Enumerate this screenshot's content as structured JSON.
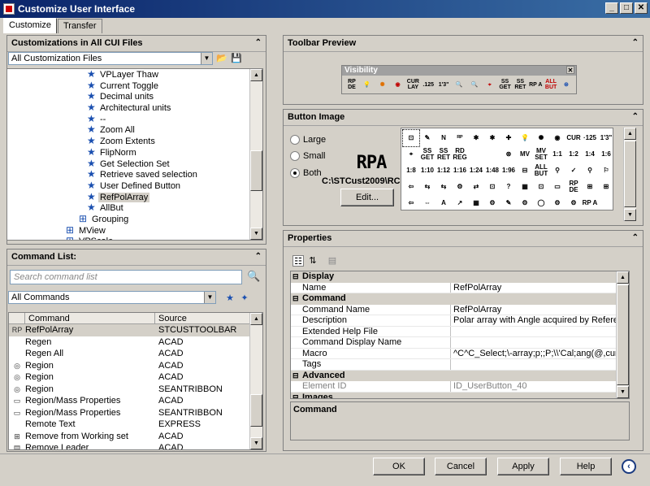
{
  "window": {
    "title": "Customize User Interface"
  },
  "tabs": [
    {
      "label": "Customize"
    },
    {
      "label": "Transfer"
    }
  ],
  "left_top": {
    "header": "Customizations in All CUI Files",
    "file_combo": "All Customization Files",
    "tree_items": [
      {
        "label": "VPLayer Thaw"
      },
      {
        "label": "Current Toggle"
      },
      {
        "label": "Decimal units"
      },
      {
        "label": "Architectural units"
      },
      {
        "label": "--"
      },
      {
        "label": "Zoom All"
      },
      {
        "label": "Zoom Extents"
      },
      {
        "label": "FlipNorm"
      },
      {
        "label": "Get Selection Set"
      },
      {
        "label": "Retrieve saved selection"
      },
      {
        "label": "User Defined Button"
      },
      {
        "label": "RefPolArray"
      },
      {
        "label": "AllBut"
      },
      {
        "label": "Grouping"
      },
      {
        "label": "MView"
      },
      {
        "label": "VPScale"
      }
    ]
  },
  "command_list": {
    "header": "Command List:",
    "search_placeholder": "Search command list",
    "filter_combo": "All Commands",
    "col_command": "Command",
    "col_source": "Source",
    "rows": [
      {
        "icon": "RP",
        "command": "RefPolArray",
        "source": "STCUSTTOOLBAR"
      },
      {
        "icon": "",
        "command": "Regen",
        "source": "ACAD"
      },
      {
        "icon": "",
        "command": "Regen All",
        "source": "ACAD"
      },
      {
        "icon": "◎",
        "command": "Region",
        "source": "ACAD"
      },
      {
        "icon": "◎",
        "command": "Region",
        "source": "ACAD"
      },
      {
        "icon": "◎",
        "command": "Region",
        "source": "SEANTRIBBON"
      },
      {
        "icon": "▭",
        "command": "Region/Mass Properties",
        "source": "ACAD"
      },
      {
        "icon": "▭",
        "command": "Region/Mass Properties",
        "source": "SEANTRIBBON"
      },
      {
        "icon": "",
        "command": "Remote Text",
        "source": "EXPRESS"
      },
      {
        "icon": "⊞",
        "command": "Remove from Working set",
        "source": "ACAD"
      },
      {
        "icon": "▤",
        "command": "Remove Leader",
        "source": "ACAD"
      }
    ]
  },
  "toolbar_preview": {
    "header": "Toolbar Preview",
    "toolbar_title": "Visibility",
    "icons": [
      "RP DE",
      "💡",
      "✺",
      "◉",
      "CUR LAY",
      ".125",
      "1'3\"",
      "🔍",
      "🔍",
      "⌖",
      "SS GET",
      "SS RET",
      "RP A",
      "ALL BUT",
      "⊛"
    ]
  },
  "button_image": {
    "header": "Button Image",
    "size_options": [
      {
        "label": "Large",
        "selected": false
      },
      {
        "label": "Small",
        "selected": false
      },
      {
        "label": "Both",
        "selected": true
      }
    ],
    "preview_text": "RPA",
    "path": "C:\\STCust2009\\RCD...",
    "edit_label": "Edit...",
    "grid_icons": [
      "⊡",
      "✎",
      "N",
      "ᴿᴾ",
      "✱",
      "✱",
      "✚",
      "💡",
      "✺",
      "◉",
      "CUR",
      "·125",
      "1'3\"",
      "⌖",
      "SS GET",
      "SS RET",
      "RD REG",
      "",
      "",
      "⊛",
      "MV",
      "MV SET",
      "1:1",
      "1:2",
      "1:4",
      "1:6",
      "1:8",
      "1:10",
      "1:12",
      "1:16",
      "1:24",
      "1:48",
      "1:96",
      "⊟",
      "ALL BUT",
      "⚲",
      "✓",
      "⚲",
      "⚐",
      "⇦",
      "⇆",
      "⇆",
      "⚙",
      "⇄",
      "⊡",
      "?",
      "▦",
      "⊡",
      "▭",
      "RP DE",
      "⊞",
      "⊞",
      "⇦",
      "⇔",
      "A",
      "↗",
      "▦",
      "⚙",
      "✎",
      "⚙",
      "◯",
      "⚙",
      "⚙",
      "RP A",
      ""
    ]
  },
  "properties": {
    "header": "Properties",
    "categories": [
      {
        "name": "Display",
        "rows": [
          {
            "key": "Name",
            "value": "RefPolArray",
            "gray": false
          }
        ]
      },
      {
        "name": "Command",
        "rows": [
          {
            "key": "Command Name",
            "value": "RefPolArray",
            "gray": false
          },
          {
            "key": "Description",
            "value": "Polar array with Angle acquired by Reference",
            "gray": false
          },
          {
            "key": "Extended Help File",
            "value": "",
            "gray": false
          },
          {
            "key": "Command Display Name",
            "value": "",
            "gray": false
          },
          {
            "key": "Macro",
            "value": "^C^C_Select;\\-array;p;;P;\\\\'Cal;ang(@,cur,cur);",
            "gray": false
          },
          {
            "key": "Tags",
            "value": "",
            "gray": false
          }
        ]
      },
      {
        "name": "Advanced",
        "rows": [
          {
            "key": "Element ID",
            "value": "ID_UserButton_40",
            "gray": true
          }
        ]
      },
      {
        "name": "Images",
        "rows": []
      }
    ],
    "description_title": "Command"
  },
  "footer": {
    "ok": "OK",
    "cancel": "Cancel",
    "apply": "Apply",
    "help": "Help"
  }
}
